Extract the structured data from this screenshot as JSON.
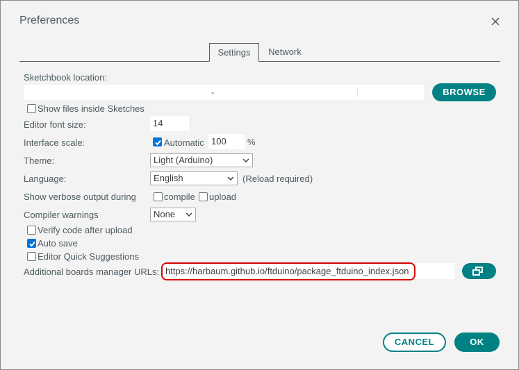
{
  "window": {
    "title": "Preferences",
    "close_icon": "close-icon"
  },
  "tabs": [
    {
      "label": "Settings",
      "active": true
    },
    {
      "label": "Network",
      "active": false
    }
  ],
  "sketchbook": {
    "label": "Sketchbook location:",
    "value": "",
    "cursor_mark": "-",
    "browse_label": "BROWSE"
  },
  "show_files": {
    "label": "Show files inside Sketches",
    "checked": false
  },
  "font_size": {
    "label": "Editor font size:",
    "value": "14"
  },
  "interface_scale": {
    "label": "Interface scale:",
    "automatic_label": "Automatic",
    "automatic_checked": true,
    "value": "100",
    "unit": "%"
  },
  "theme": {
    "label": "Theme:",
    "value": "Light (Arduino)"
  },
  "language": {
    "label": "Language:",
    "value": "English",
    "note": "(Reload required)"
  },
  "verbose": {
    "label": "Show verbose output during",
    "compile_label": "compile",
    "compile_checked": false,
    "upload_label": "upload",
    "upload_checked": false
  },
  "compiler_warnings": {
    "label": "Compiler warnings",
    "value": "None"
  },
  "verify_after_upload": {
    "label": "Verify code after upload",
    "checked": false
  },
  "auto_save": {
    "label": "Auto save",
    "checked": true
  },
  "quick_suggestions": {
    "label": "Editor Quick Suggestions",
    "checked": false
  },
  "boards_urls": {
    "label": "Additional boards manager URLs:",
    "value": "https://harbaum.github.io/ftduino/package_ftduino_index.json",
    "edit_icon": "open-window-icon"
  },
  "footer": {
    "cancel_label": "CANCEL",
    "ok_label": "OK"
  },
  "colors": {
    "accent": "#008184",
    "checkbox": "#0075d9",
    "highlight": "#d40000"
  }
}
